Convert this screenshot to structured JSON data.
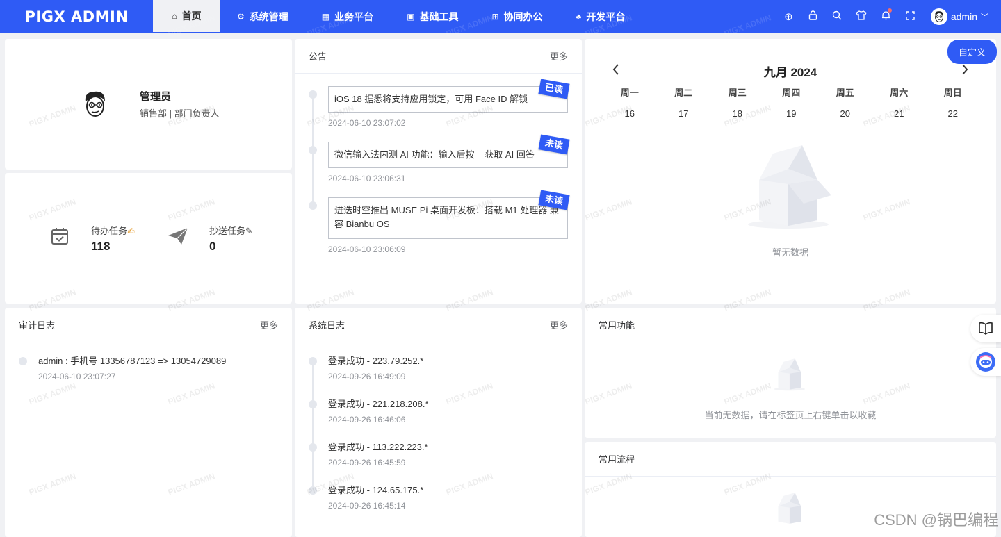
{
  "header": {
    "logo": "PIGX ADMIN",
    "nav": [
      {
        "label": "首页",
        "icon": "⌂"
      },
      {
        "label": "系统管理",
        "icon": "⚙"
      },
      {
        "label": "业务平台",
        "icon": "▦"
      },
      {
        "label": "基础工具",
        "icon": "▣"
      },
      {
        "label": "协同办公",
        "icon": "⊞"
      },
      {
        "label": "开发平台",
        "icon": "♣"
      }
    ],
    "username": "admin"
  },
  "profile": {
    "name": "管理员",
    "dept": "销售部 | 部门负责人"
  },
  "tasks": [
    {
      "label": "待办任务",
      "value": "118",
      "badge": "✍"
    },
    {
      "label": "抄送任务",
      "value": "0",
      "badge": "✎"
    }
  ],
  "notice": {
    "title": "公告",
    "more": "更多",
    "items": [
      {
        "text": "iOS 18 据悉将支持应用锁定，可用 Face ID 解锁",
        "time": "2024-06-10 23:07:02",
        "tag": "已读"
      },
      {
        "text": "微信输入法内测 AI 功能：输入后按 = 获取 AI 回答",
        "time": "2024-06-10 23:06:31",
        "tag": "未读"
      },
      {
        "text": "进迭时空推出 MUSE Pi 桌面开发板：搭载 M1 处理器 兼容 Bianbu OS",
        "time": "2024-06-10 23:06:09",
        "tag": "未读"
      }
    ]
  },
  "calendar": {
    "title": "九月 2024",
    "weekdays": [
      "周一",
      "周二",
      "周三",
      "周四",
      "周五",
      "周六",
      "周日"
    ],
    "days": [
      "16",
      "17",
      "18",
      "19",
      "20",
      "21",
      "22"
    ],
    "empty": "暂无数据"
  },
  "custom_button": "自定义",
  "audit": {
    "title": "审计日志",
    "more": "更多",
    "items": [
      {
        "text": "admin : 手机号 13356787123 => 13054729089",
        "time": "2024-06-10 23:07:27"
      }
    ]
  },
  "syslog": {
    "title": "系统日志",
    "more": "更多",
    "items": [
      {
        "text": "登录成功 - 223.79.252.*",
        "time": "2024-09-26 16:49:09"
      },
      {
        "text": "登录成功 - 221.218.208.*",
        "time": "2024-09-26 16:46:06"
      },
      {
        "text": "登录成功 - 113.222.223.*",
        "time": "2024-09-26 16:45:59"
      },
      {
        "text": "登录成功 - 124.65.175.*",
        "time": "2024-09-26 16:45:14"
      }
    ]
  },
  "functions": {
    "title": "常用功能",
    "empty": "当前无数据，请在标签页上右键单击以收藏"
  },
  "process": {
    "title": "常用流程"
  },
  "watermark": "PIGX ADMIN",
  "footer_watermark": "CSDN @锅巴编程"
}
